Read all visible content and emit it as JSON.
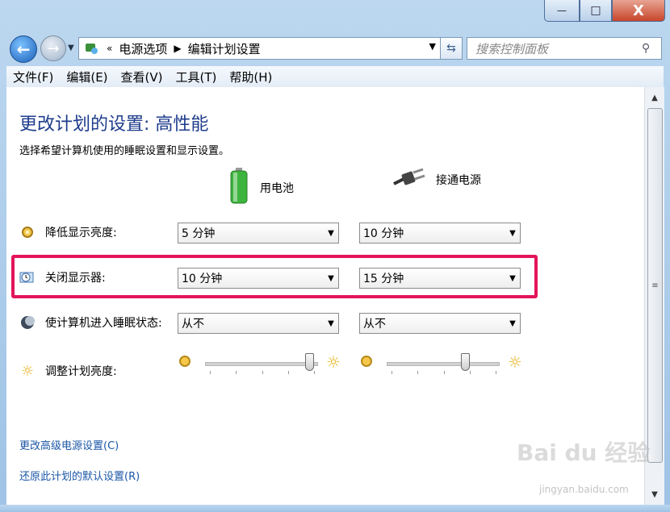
{
  "window": {
    "minimize": "—",
    "maximize": "□",
    "close": "X"
  },
  "nav": {
    "back": "←",
    "forward": "→",
    "breadcrumb_chevron": "«",
    "breadcrumb": [
      "电源选项",
      "编辑计划设置"
    ],
    "search_placeholder": "搜索控制面板"
  },
  "menu": [
    "文件(F)",
    "编辑(E)",
    "查看(V)",
    "工具(T)",
    "帮助(H)"
  ],
  "page": {
    "title": "更改计划的设置: 高性能",
    "description": "选择希望计算机使用的睡眠设置和显示设置。",
    "columns": {
      "battery": "用电池",
      "plugged": "接通电源"
    }
  },
  "rows": {
    "dim": {
      "label": "降低显示亮度:",
      "battery": "5 分钟",
      "plugged": "10 分钟"
    },
    "display_off": {
      "label": "关闭显示器:",
      "battery": "10 分钟",
      "plugged": "15 分钟"
    },
    "sleep": {
      "label": "使计算机进入睡眠状态:",
      "battery": "从不",
      "plugged": "从不"
    },
    "brightness": {
      "label": "调整计划亮度:",
      "battery_level": 1.0,
      "plugged_level": 0.75
    }
  },
  "links": {
    "advanced": "更改高级电源设置(C)",
    "restore": "还原此计划的默认设置(R)"
  },
  "watermark": {
    "main": "Bai du 经验",
    "sub": "jingyan.baidu.com"
  },
  "colors": {
    "title": "#1e3c8c",
    "link": "#1a56a6",
    "highlight": "#e3155a"
  }
}
